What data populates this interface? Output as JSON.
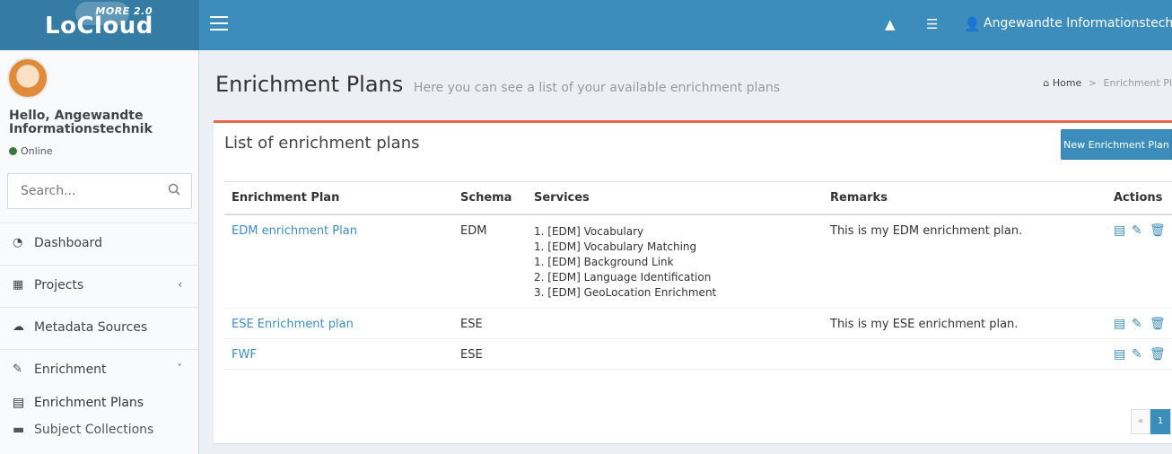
{
  "brand": {
    "name": "LoCloud",
    "tag": "MORE 2.0"
  },
  "topbar": {
    "user_name": "Angewandte Informationstechnik",
    "alert_icon": "warning-icon",
    "tasks_icon": "tasks-icon",
    "user_icon": "user-icon"
  },
  "sidebar": {
    "greeting": "Hello, Angewandte Informationstechnik",
    "status": "Online",
    "search_placeholder": "Search...",
    "items": [
      {
        "label": "Dashboard",
        "icon": "dashboard-icon"
      },
      {
        "label": "Projects",
        "icon": "table-icon",
        "arrow": "‹"
      },
      {
        "label": "Metadata Sources",
        "icon": "cloud-icon"
      },
      {
        "label": "Enrichment",
        "icon": "magic-wand-icon",
        "arrow": "˅"
      }
    ],
    "sub_items": [
      {
        "label": "Enrichment Plans",
        "icon": "file-icon"
      },
      {
        "label": "Subject Collections",
        "icon": "archive-icon"
      }
    ]
  },
  "header": {
    "title": "Enrichment Plans",
    "subtitle": "Here you can see a list of your available enrichment plans",
    "breadcrumb_home": "Home",
    "breadcrumb_current": "Enrichment Pl"
  },
  "box": {
    "title": "List of enrichment plans",
    "new_button": "New Enrichment Plan"
  },
  "table": {
    "headers": [
      "Enrichment Plan",
      "Schema",
      "Services",
      "Remarks",
      "Actions"
    ],
    "rows": [
      {
        "plan": "EDM enrichment Plan",
        "schema": "EDM",
        "services": [
          "1. [EDM] Vocabulary",
          "1. [EDM] Vocabulary Matching",
          "1. [EDM] Background Link",
          "2. [EDM] Language Identification",
          "3. [EDM] GeoLocation Enrichment"
        ],
        "remarks": "This is my EDM enrichment plan."
      },
      {
        "plan": "ESE Enrichment plan",
        "schema": "ESE",
        "services": [],
        "remarks": "This is my ESE enrichment plan."
      },
      {
        "plan": "FWF",
        "schema": "ESE",
        "services": [],
        "remarks": ""
      }
    ]
  },
  "pagination": {
    "prev": "«",
    "current": "1",
    "next": "»"
  },
  "colors": {
    "topbar": "#3c8dbc",
    "logo_bg": "#357ca5",
    "accent": "#3c8dbc",
    "box_top": "#e8684a"
  }
}
